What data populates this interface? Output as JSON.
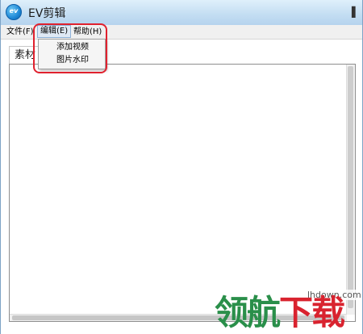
{
  "window": {
    "title": "EV剪辑",
    "logo_text": "ev"
  },
  "menubar": {
    "items": [
      {
        "label": "文件(F)"
      },
      {
        "label": "编辑(E)"
      },
      {
        "label": "帮助(H)"
      }
    ]
  },
  "dropdown": {
    "items": [
      {
        "label": "添加视频"
      },
      {
        "label": "图片水印"
      }
    ]
  },
  "panel": {
    "label": "素材"
  },
  "watermark": {
    "site": "lhdown.com",
    "text_green": "领航",
    "text_red": "下载"
  },
  "colors": {
    "highlight": "#e0212e",
    "watermark_green": "#2a8f4a",
    "watermark_red": "#d9232f"
  }
}
